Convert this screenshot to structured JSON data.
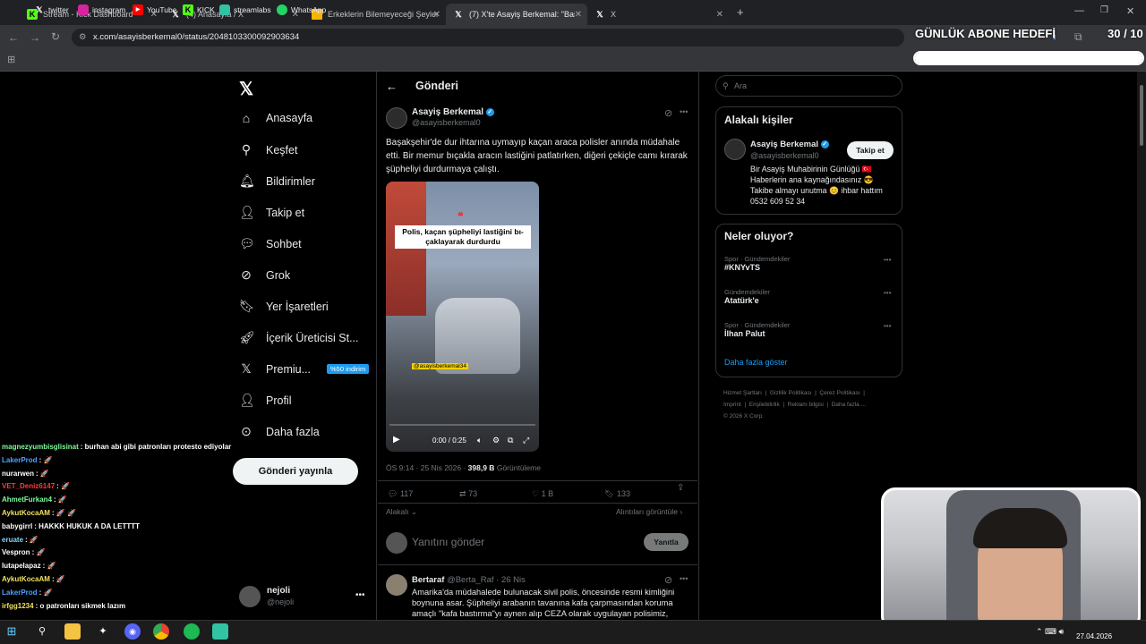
{
  "browser": {
    "tabs": [
      {
        "title": "Stream - Kick Dashboard"
      },
      {
        "title": "(4) Anasayfa / X"
      },
      {
        "title": "Erkeklerin Bilemeyeceği Şeyler"
      },
      {
        "title": "(7) X'te Asayiş Berkemal: \"Başak"
      },
      {
        "title": "X"
      }
    ],
    "url": "x.com/asayisberkemal0/status/2048103300092903634",
    "bookmarks": [
      "twitter",
      "instagram",
      "YouTube",
      "KICK",
      "streamlabs",
      "WhatsApp"
    ]
  },
  "overlay": {
    "goal_title": "GÜNLÜK ABONE HEDEFİ",
    "goal_count": "30 / 10"
  },
  "nav": {
    "items": [
      "Anasayfa",
      "Keşfet",
      "Bildirimler",
      "Takip et",
      "Sohbet",
      "Grok",
      "Yer İşaretleri",
      "İçerik Üreticisi St...",
      "Premiu...",
      "Profil",
      "Daha fazla"
    ],
    "premium_badge": "%50 indirim",
    "post_button": "Gönderi yayınla",
    "account_name": "nejoli",
    "account_handle": "@nejoli"
  },
  "post": {
    "header": "Gönderi",
    "author_name": "Asayiş Berkemal",
    "author_handle": "@asayisberkemal0",
    "text": "Başakşehir'de dur ihtarına uymayıp kaçan araca polisler anında müdahale etti. Bir memur bıçakla aracın lastiğini patlatırken, diğeri çekiçle camı kırarak şüpheliyi durdurmaya çalıştı.",
    "video_caption": "Polis, kaçan şüpheliyi lastiğini bı-çaklayarak durdurdu",
    "video_watermark": "@asayisberkemal34",
    "video_time": "0:00 / 0:25",
    "time": "ÖS 9:14 · 25 Nis 2026",
    "views_count": "398,9 B",
    "views_label": "Görüntüleme",
    "replies": "117",
    "reposts": "73",
    "likes": "1 B",
    "bookmarks": "133",
    "relevant_label": "Alakalı",
    "quotes_label": "Alıntıları görüntüle",
    "reply_placeholder": "Yanıtını gönder",
    "reply_button": "Yanıtla"
  },
  "reply1": {
    "name": "Bertaraf",
    "handle": "@Berta_Raf",
    "date": "26 Nis",
    "text": "Amarika'da müdahalede bulunacak sivil polis, öncesinde resmi kimliğini boynuna asar. Şüpheliyi arabanın tavanına kafa çarpmasından koruma amaçlı \"kafa bastırma\"yı aynen alıp CEZA olarak uygulayan polisimiz, rozeti"
  },
  "right": {
    "search_placeholder": "Ara",
    "related_title": "Alakalı kişiler",
    "related_name": "Asayiş Berkemal",
    "related_handle": "@asayisberkemal0",
    "follow_button": "Takip et",
    "bio": "Bir Asayiş Muhabirinin Günlüğü 🇹🇷 Haberlerin ana kaynağındasınız 😎 Takibe almayı unutma 😊 ihbar hattım 0532 609 52 34",
    "trends_title": "Neler oluyor?",
    "trends": [
      {
        "category": "Spor · Gündemdekiler",
        "name": "#KNYvTS"
      },
      {
        "category": "Gündemdekiler",
        "name": "Atatürk'e"
      },
      {
        "category": "Spor · Gündemdekiler",
        "name": "İlhan Palut"
      }
    ],
    "show_more": "Daha fazla göster",
    "footer": [
      "Hizmet Şartları",
      "Gizlilik Politikası",
      "Çerez Politikası",
      "Imprint",
      "Erişilebilirlik",
      "Reklam bilgisi",
      "Daha fazla ...",
      "© 2026 X Corp."
    ]
  },
  "chat": [
    {
      "user": "magnezyumbisglisinat",
      "msg": ": burhan abi gibi patronları protesto ediyolar",
      "color": "#7cfc9a"
    },
    {
      "user": "LakerProd",
      "msg": ": 🚀",
      "color": "#4da3ff"
    },
    {
      "user": "nurarwen",
      "msg": ": 🚀",
      "color": "#ffffff"
    },
    {
      "user": "VET_Deniz6147",
      "msg": ": 🚀",
      "color": "#ff3b3b"
    },
    {
      "user": "AhmetFurkan4",
      "msg": ": 🚀",
      "color": "#7cfc9a"
    },
    {
      "user": "AykutKocaAM",
      "msg": ": 🚀 🚀",
      "color": "#f0e060"
    },
    {
      "user": "babygirrl",
      "msg": ": HAKKK HUKUK A DA LETTTT",
      "color": "#ffffff"
    },
    {
      "user": "eruate",
      "msg": ": 🚀",
      "color": "#7fd6ff"
    },
    {
      "user": "Vespron",
      "msg": ": 🚀",
      "color": "#ffffff"
    },
    {
      "user": "lutapelapaz",
      "msg": ": 🚀",
      "color": "#ffffff"
    },
    {
      "user": "AykutKocaAM",
      "msg": ": 🚀",
      "color": "#f0e060"
    },
    {
      "user": "LakerProd",
      "msg": ": 🚀",
      "color": "#4da3ff"
    },
    {
      "user": "irfgg1234",
      "msg": ": o patronları sikmek lazım",
      "color": "#f0e060"
    }
  ],
  "taskbar": {
    "date": "27.04.2026"
  }
}
